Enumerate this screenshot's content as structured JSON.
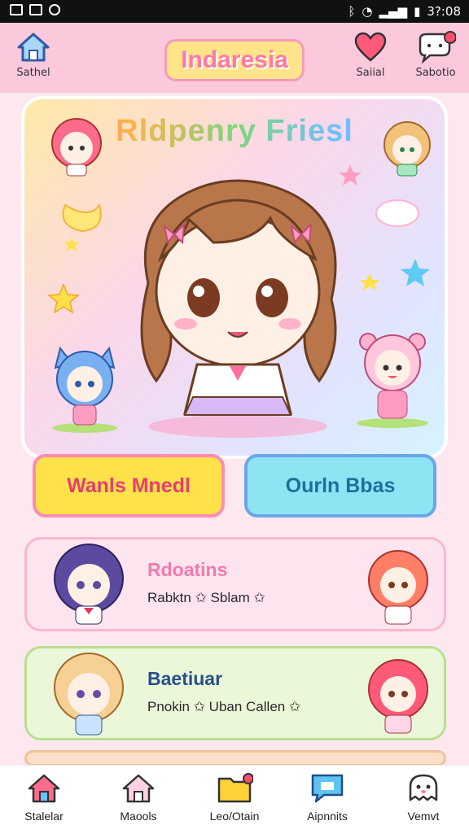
{
  "status": {
    "time": "3?:08"
  },
  "header": {
    "left_label": "Sathel",
    "title": "Indaresia",
    "right1_label": "Saiial",
    "right2_label": "Sabotio"
  },
  "hero": {
    "title": "Rldpenry Friesl"
  },
  "actions": [
    {
      "label": "Wanls Mnedl"
    },
    {
      "label": "Ourln Bbas"
    }
  ],
  "cards": [
    {
      "title": "Rdoatins",
      "subtitle": "Rabktn ✩ Sblam ✩"
    },
    {
      "title": "Baetiuar",
      "subtitle": "Pnokin ✩ Uban Callen ✩"
    }
  ],
  "nav": [
    {
      "label": "Stalelar",
      "icon": "house-icon"
    },
    {
      "label": "Maools",
      "icon": "home-icon"
    },
    {
      "label": "Leo/Otain",
      "icon": "folder-icon"
    },
    {
      "label": "Aipnnits",
      "icon": "chat-icon"
    },
    {
      "label": "Vemvt",
      "icon": "ghost-icon"
    }
  ],
  "colors": {
    "accent": "#ff7aa6",
    "header": "#fbc8dc",
    "yellow": "#ffe24a",
    "cyan": "#8fe4f4"
  }
}
